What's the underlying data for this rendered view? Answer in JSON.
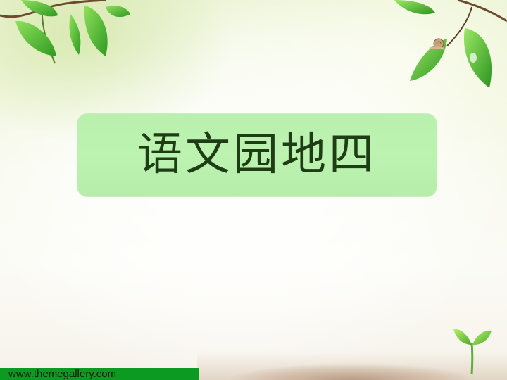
{
  "slide": {
    "title": "语文园地四",
    "footer_url": "www.themegallery.com"
  },
  "decorations": {
    "top_left": "leaf-branch-icon",
    "top_right": "leaf-branch-with-snail-icon",
    "bottom_right": "seedling-icon",
    "bottom": "soil-ground"
  },
  "colors": {
    "title_box": "#bdf3b1",
    "title_text": "#1f3d14",
    "footer_bar": "#0d9a22",
    "leaf": "#5cc23a"
  }
}
